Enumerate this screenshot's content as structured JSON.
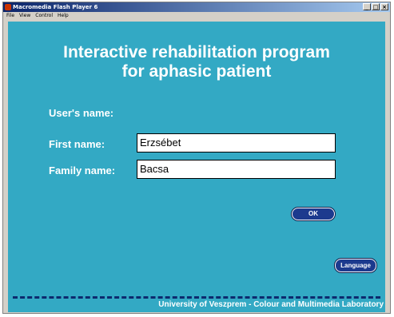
{
  "window": {
    "title": "Macromedia Flash Player 6",
    "buttons": [
      "_",
      "□",
      "×"
    ]
  },
  "menu": [
    "File",
    "View",
    "Control",
    "Help"
  ],
  "app": {
    "title_line1": "Interactive rehabilitation program",
    "title_line2": "for aphasic patient",
    "users_name_label": "User's name:",
    "first_name_label": "First name:",
    "first_name_value": "Erzsébet",
    "family_name_label": "Family name:",
    "family_name_value": "Bacsa",
    "ok_label": "OK",
    "language_label": "Language",
    "footer": "University of Veszprem - Colour and Multimedia Laboratory"
  },
  "colors": {
    "background": "#33a9c4",
    "button": "#1c3a8e",
    "dashes": "#0d2a6e"
  }
}
